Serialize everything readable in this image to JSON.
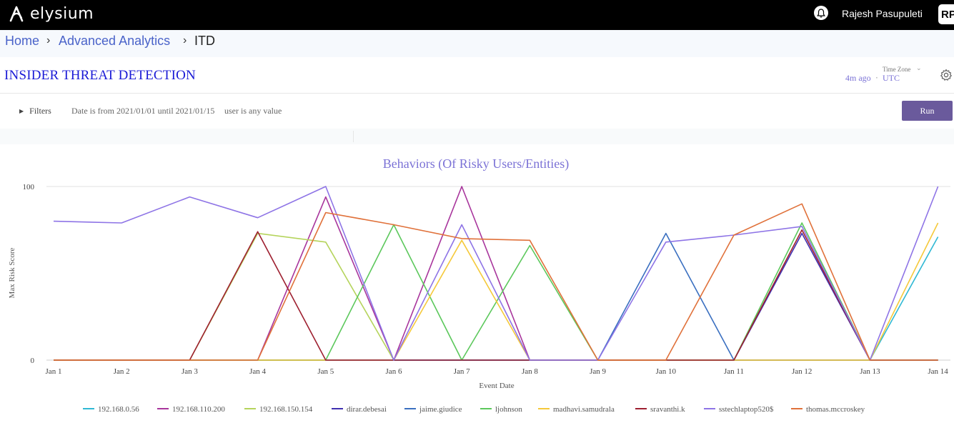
{
  "app": {
    "logo_text": "elysium",
    "user_name": "Rajesh Pasupuleti",
    "avatar_initials": "RP"
  },
  "breadcrumb": {
    "home": "Home",
    "analytics": "Advanced Analytics",
    "current": "ITD",
    "separator": "›"
  },
  "page": {
    "title": "INSIDER THREAT DETECTION",
    "updated_ago": "4m ago",
    "time_zone_label": "Time Zone",
    "time_zone_value": "UTC"
  },
  "filters": {
    "toggle_label": "Filters",
    "date_filter": "Date is from 2021/01/01 until 2021/01/15",
    "user_filter": "user is any value",
    "run_label": "Run"
  },
  "colors": {
    "accent": "#6a5a9c",
    "link": "#4a63c9",
    "title": "#1a1ad6",
    "chart_title": "#7b72d6"
  },
  "chart_data": {
    "type": "line",
    "title": "Behaviors (Of Risky Users/Entities)",
    "xlabel": "Event Date",
    "ylabel": "Max Risk Score",
    "ylim": [
      0,
      100
    ],
    "yticks": [
      0,
      100
    ],
    "grid": true,
    "legend_position": "bottom",
    "categories": [
      "Jan 1",
      "Jan 2",
      "Jan 3",
      "Jan 4",
      "Jan 5",
      "Jan 6",
      "Jan 7",
      "Jan 8",
      "Jan 9",
      "Jan 10",
      "Jan 11",
      "Jan 12",
      "Jan 13",
      "Jan 14"
    ],
    "series": [
      {
        "name": "192.168.0.56",
        "color": "#2fb8d4",
        "values": [
          0,
          0,
          0,
          0,
          0,
          0,
          0,
          0,
          0,
          0,
          0,
          0,
          0,
          71
        ]
      },
      {
        "name": "192.168.110.200",
        "color": "#a8359c",
        "values": [
          0,
          0,
          0,
          0,
          94,
          0,
          100,
          0,
          0,
          0,
          0,
          0,
          0,
          0
        ]
      },
      {
        "name": "192.168.150.154",
        "color": "#b5d45c",
        "values": [
          0,
          0,
          0,
          73,
          68,
          0,
          0,
          0,
          0,
          0,
          0,
          0,
          0,
          0
        ]
      },
      {
        "name": "dirar.debesai",
        "color": "#3f2fb0",
        "values": [
          0,
          0,
          0,
          0,
          0,
          0,
          0,
          0,
          0,
          0,
          0,
          73,
          0,
          0
        ]
      },
      {
        "name": "jaime.giudice",
        "color": "#3a6fc0",
        "values": [
          0,
          0,
          0,
          0,
          0,
          0,
          0,
          0,
          0,
          73,
          0,
          0,
          0,
          0
        ]
      },
      {
        "name": "ljohnson",
        "color": "#5cc85c",
        "values": [
          0,
          0,
          0,
          0,
          0,
          78,
          0,
          66,
          0,
          0,
          0,
          79,
          0,
          0
        ]
      },
      {
        "name": "madhavi.samudrala",
        "color": "#f5c93a",
        "values": [
          0,
          0,
          0,
          0,
          0,
          0,
          69,
          0,
          0,
          0,
          0,
          0,
          0,
          79
        ]
      },
      {
        "name": "sravanthi.k",
        "color": "#9e2030",
        "values": [
          0,
          0,
          0,
          74,
          0,
          0,
          0,
          0,
          0,
          0,
          0,
          75,
          0,
          0
        ]
      },
      {
        "name": "sstechlaptop520$",
        "color": "#8e74e6",
        "values": [
          80,
          79,
          94,
          82,
          100,
          0,
          78,
          0,
          0,
          68,
          72,
          77,
          0,
          100
        ]
      },
      {
        "name": "thomas.mccroskey",
        "color": "#e0713a",
        "values": [
          0,
          0,
          0,
          0,
          85,
          78,
          70,
          69,
          0,
          0,
          72,
          90,
          0,
          0
        ]
      }
    ]
  }
}
